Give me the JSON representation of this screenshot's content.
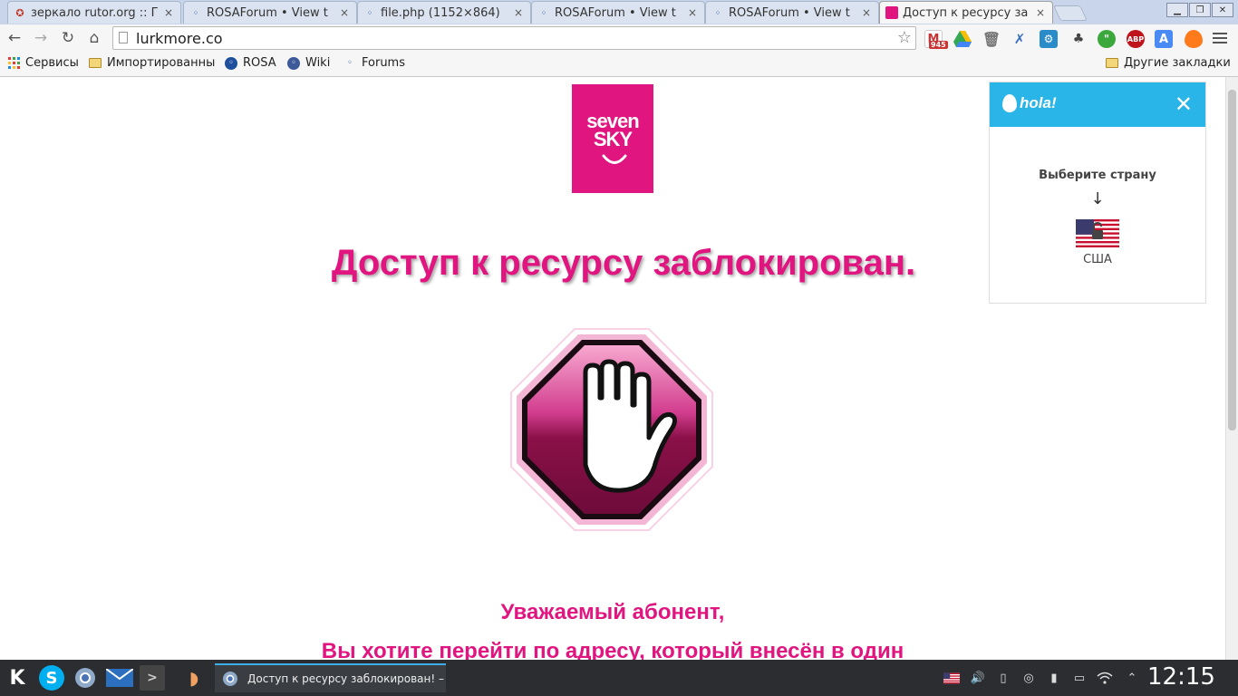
{
  "browser": {
    "tabs": [
      {
        "title": "зеркало rutor.org :: Г",
        "icon": "soviet-star-icon",
        "active": false
      },
      {
        "title": "ROSAForum • View t",
        "icon": "rosa-icon",
        "active": false
      },
      {
        "title": "file.php (1152×864)",
        "icon": "rosa-icon",
        "active": false
      },
      {
        "title": "ROSAForum • View t",
        "icon": "rosa-icon",
        "active": false
      },
      {
        "title": "ROSAForum • View t",
        "icon": "rosa-icon",
        "active": false
      },
      {
        "title": "Доступ к ресурсу за",
        "icon": "sevensky-icon",
        "active": true
      }
    ],
    "tab_close": "×",
    "url": "lurkmore.co",
    "gmail_count": "945",
    "abp_label": "ABP",
    "bookmarks": [
      {
        "label": "Сервисы",
        "icon": "apps-grid-icon"
      },
      {
        "label": "Импортированные",
        "icon": "folder-icon"
      },
      {
        "label": "ROSA",
        "icon": "rosa-icon"
      },
      {
        "label": "Wiki",
        "icon": "wiki-icon"
      },
      {
        "label": "Forums",
        "icon": "rosa-icon"
      }
    ],
    "other_bookmarks": "Другие закладки"
  },
  "page": {
    "logo_line1": "seven",
    "logo_line2": "SKY",
    "headline": "Доступ к ресурсу заблокирован.",
    "greeting": "Уважаемый абонент,",
    "message": "Вы хотите перейти по адресу, который внесён в один",
    "accent_color": "#e0157f"
  },
  "hola": {
    "brand": "hola!",
    "close": "✕",
    "prompt": "Выберите страну",
    "arrow": "↓",
    "country": "США",
    "header_color": "#2ab5e8"
  },
  "taskbar": {
    "task_title": "Доступ к ресурсу заблокирован! – Chromium",
    "clock": "12:15"
  }
}
